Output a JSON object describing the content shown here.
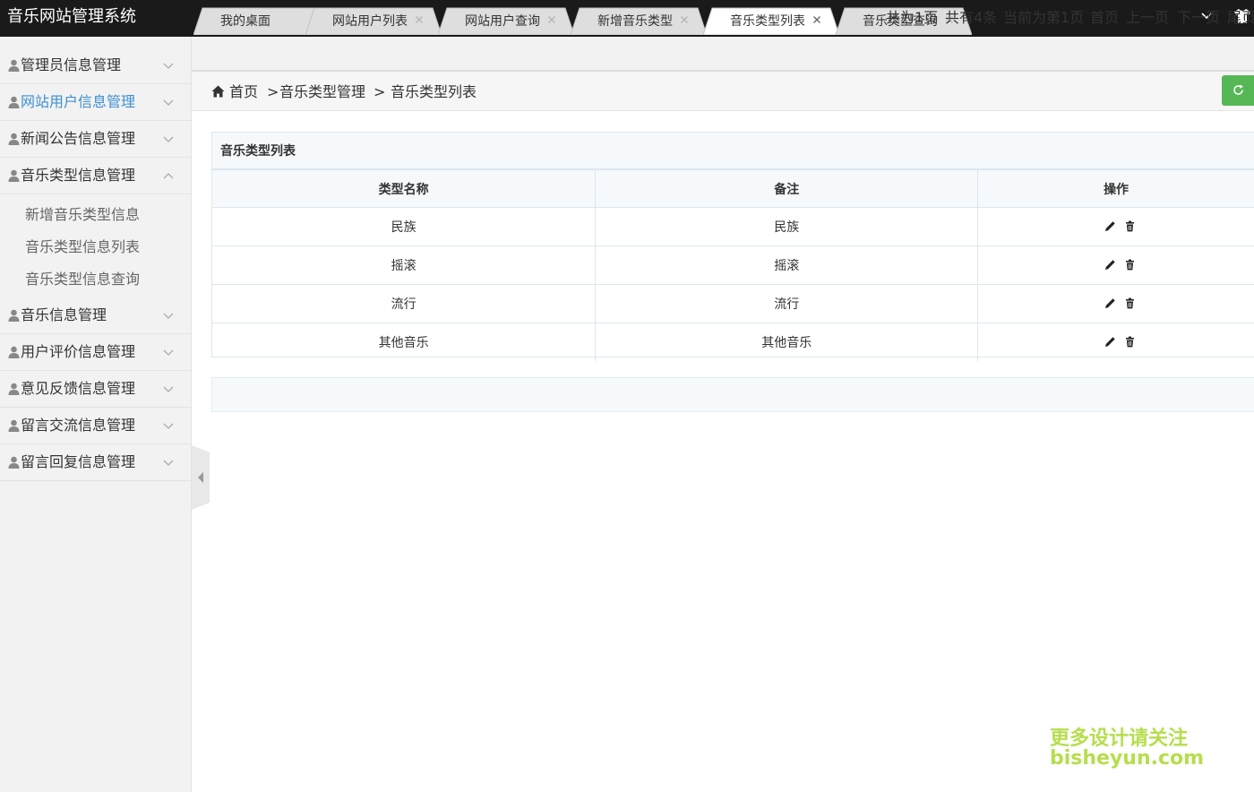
{
  "header": {
    "title": "音乐网站管理系统",
    "dropdown_icon": "chevron-down-icon",
    "theme_icon": "tshirt-icon",
    "background": "#1a1a1a"
  },
  "sidebar": {
    "items": [
      {
        "label": "管理员信息管理",
        "expanded": false
      },
      {
        "label": "网站用户信息管理",
        "expanded": false,
        "active": true
      },
      {
        "label": "新闻公告信息管理",
        "expanded": false
      },
      {
        "label": "音乐类型信息管理",
        "expanded": true,
        "children": [
          "新增音乐类型信息",
          "音乐类型信息列表",
          "音乐类型信息查询"
        ]
      },
      {
        "label": "音乐信息管理",
        "expanded": false
      },
      {
        "label": "用户评价信息管理",
        "expanded": false
      },
      {
        "label": "意见反馈信息管理",
        "expanded": false
      },
      {
        "label": "留言交流信息管理",
        "expanded": false
      },
      {
        "label": "留言回复信息管理",
        "expanded": false
      }
    ],
    "active_color": "#3d8fd1"
  },
  "tabs": [
    {
      "label": "我的桌面",
      "closable": false,
      "active": false
    },
    {
      "label": "网站用户列表",
      "closable": true,
      "active": false
    },
    {
      "label": "网站用户查询",
      "closable": true,
      "active": false
    },
    {
      "label": "新增音乐类型",
      "closable": true,
      "active": false
    },
    {
      "label": "音乐类型列表",
      "closable": true,
      "active": true
    },
    {
      "label": "音乐类型查询",
      "closable": true,
      "active": false
    }
  ],
  "breadcrumb": {
    "home": "首页",
    "sep1": ">",
    "level1": "音乐类型管理",
    "sep2": ">",
    "level2": "音乐类型列表"
  },
  "refresh_color": "#55b855",
  "panel": {
    "title": "音乐类型列表",
    "columns": [
      "类型名称",
      "备注",
      "操作"
    ],
    "rows": [
      {
        "name": "民族",
        "note": "民族"
      },
      {
        "name": "摇滚",
        "note": "摇滚"
      },
      {
        "name": "流行",
        "note": "流行"
      },
      {
        "name": "其他音乐",
        "note": "其他音乐"
      }
    ],
    "row_actions": [
      "edit-icon",
      "trash-icon"
    ]
  },
  "pagination": {
    "total_pages": "共为1页",
    "total_records": "共有4条",
    "current": "当前为第1页",
    "first": "首页",
    "prev": "上一页",
    "next": "下一页",
    "last": "尾页"
  },
  "watermark": {
    "line1": "更多设计请关注",
    "line2": "bisheyun.com",
    "color": "#b7dd4d"
  }
}
